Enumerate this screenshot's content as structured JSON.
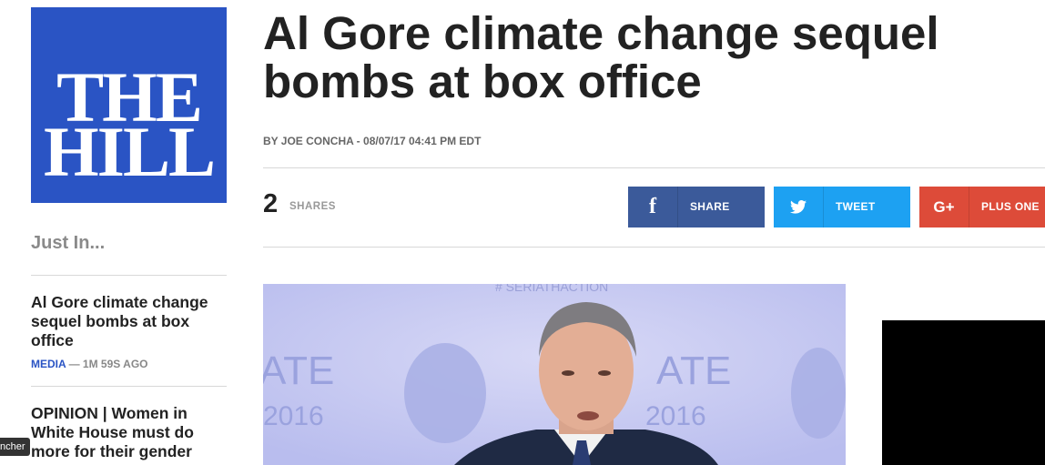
{
  "logo": {
    "line1": "THE",
    "line2": "HILL"
  },
  "sidebar": {
    "heading": "Just In...",
    "items": [
      {
        "title": "Al Gore climate change sequel bombs at box office",
        "category": "MEDIA",
        "time": "— 1M 59S AGO"
      },
      {
        "title": "OPINION | Women in White House must do more for their gender"
      }
    ]
  },
  "article": {
    "headline": "Al Gore climate change sequel bombs at box office",
    "byline": "BY JOE CONCHA - 08/07/17 04:41 PM EDT",
    "share_count": "2",
    "share_label": "SHARES"
  },
  "share_buttons": {
    "facebook": {
      "icon": "f",
      "label": "SHARE"
    },
    "twitter": {
      "label": "TWEET"
    },
    "google": {
      "icon": "G+",
      "label": "PLUS ONE"
    }
  },
  "photo_text": {
    "left": "ATE",
    "left_year": "2016",
    "right": "ATE",
    "right_year": "2016",
    "banner": "# SERIATHACTION"
  },
  "tooltip": "ncher"
}
